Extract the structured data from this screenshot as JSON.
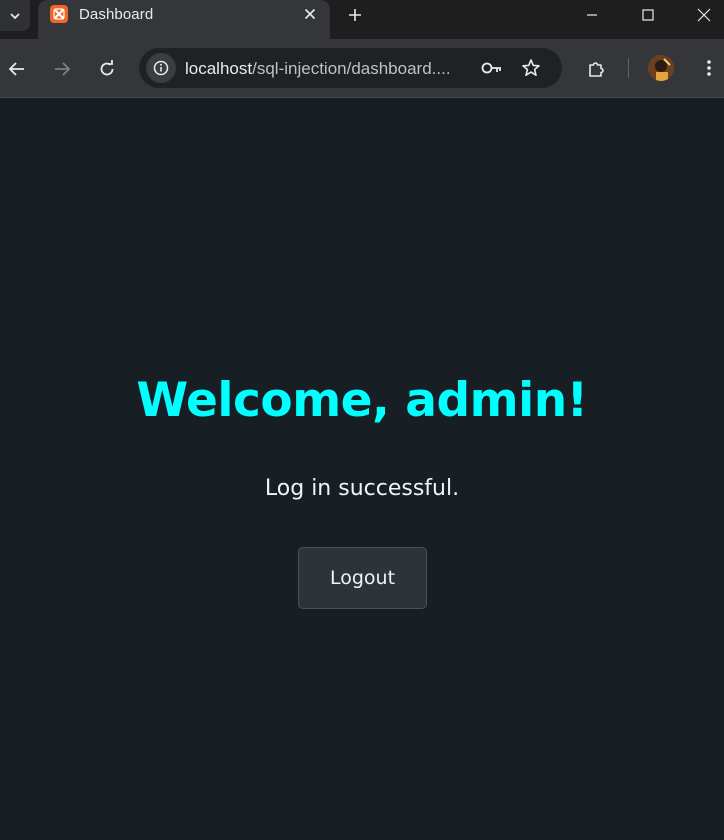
{
  "browser": {
    "tab": {
      "title": "Dashboard",
      "favicon": "xampp-icon"
    },
    "address_bar": {
      "host": "localhost",
      "path": "/sql-injection/dashboard...."
    },
    "colors": {
      "tabstrip": "#1e1e1e",
      "toolbar": "#35363a",
      "omnibox": "#202124",
      "favicon": "#f26522"
    }
  },
  "page": {
    "heading": "Welcome, admin!",
    "message": "Log in successful.",
    "logout_label": "Logout",
    "colors": {
      "background": "#171f24",
      "heading": "#00ffff",
      "text": "#f1f3f4",
      "button": "#2d3439"
    }
  }
}
